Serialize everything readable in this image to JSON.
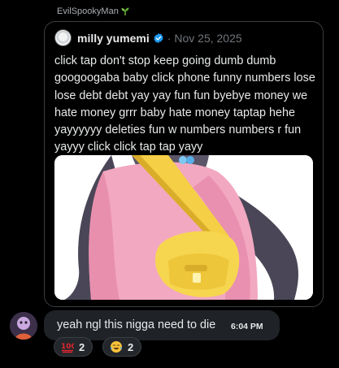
{
  "message": {
    "sender_name": "EvilSpookyMan",
    "text": "yeah ngl this nigga need to die",
    "time": "6:04 PM"
  },
  "tweet": {
    "author": "milly yumemi",
    "separator": "·",
    "date": "Nov 25, 2025",
    "body": "click tap don't stop keep going dumb dumb googoogaba baby click phone funny numbers lose lose debt debt yay yay fun fun byebye money we hate money grrr baby hate money taptap hehe yayyyyyy deleties fun w numbers numbers r fun yayyy click click tap tap yayy",
    "verified_color": "#1d9bf0"
  },
  "reactions": [
    {
      "emoji": "hundred-points-emoji",
      "count": "2"
    },
    {
      "emoji": "tears-of-joy-emoji",
      "count": "2"
    }
  ]
}
